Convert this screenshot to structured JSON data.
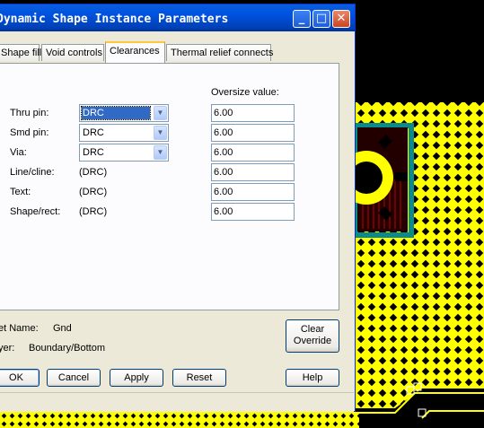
{
  "window": {
    "title": "Dynamic Shape Instance Parameters",
    "minimize": "_",
    "maximize": "□",
    "close": "✕"
  },
  "tabs": [
    {
      "label": "Shape fill"
    },
    {
      "label": "Void controls"
    },
    {
      "label": "Clearances"
    },
    {
      "label": "Thermal relief connects"
    }
  ],
  "clearances": {
    "oversize_header": "Oversize value:",
    "rows": [
      {
        "label": "Thru pin:",
        "value": "DRC",
        "oversize": "6.00"
      },
      {
        "label": "Smd pin:",
        "value": "DRC",
        "oversize": "6.00"
      },
      {
        "label": "Via:",
        "value": "DRC",
        "oversize": "6.00"
      },
      {
        "label": "Line/cline:",
        "value": "(DRC)",
        "oversize": "6.00"
      },
      {
        "label": "Text:",
        "value": "(DRC)",
        "oversize": "6.00"
      },
      {
        "label": "Shape/rect:",
        "value": "(DRC)",
        "oversize": "6.00"
      }
    ]
  },
  "info": {
    "net_label": "et Name:",
    "net_value": "Gnd",
    "layer_label": "yer:",
    "layer_value": "Boundary/Bottom"
  },
  "buttons": {
    "clear_override_line1": "Clear",
    "clear_override_line2": "Override",
    "ok": "OK",
    "cancel": "Cancel",
    "apply": "Apply",
    "reset": "Reset",
    "help": "Help"
  },
  "colors": {
    "pcb_background": "#000000",
    "copper_fill": "#ffff00",
    "title_bar": "#0054e3",
    "dialog_face": "#ece9d8",
    "selection": "#316ac5"
  }
}
